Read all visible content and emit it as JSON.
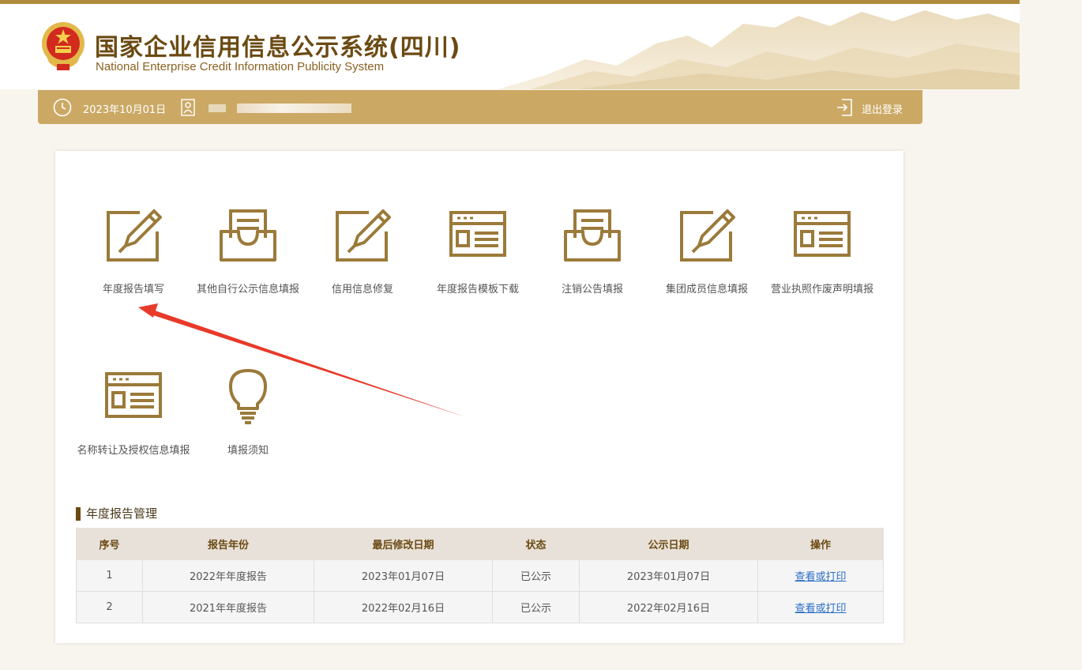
{
  "header": {
    "title_cn": "国家企业信用信息公示系统(四川)",
    "title_en": "National Enterprise Credit Information Publicity System",
    "emblem_icon": "national-emblem-icon"
  },
  "topbar": {
    "date": "2023年10月01日",
    "logout_label": "退出登录",
    "icons": [
      "clock-icon",
      "user-icon",
      "logout-icon"
    ]
  },
  "tiles": [
    {
      "label": "年度报告填写",
      "icon": "edit-pencil-icon"
    },
    {
      "label": "其他自行公示信息填报",
      "icon": "inbox-tray-icon"
    },
    {
      "label": "信用信息修复",
      "icon": "edit-pencil-icon"
    },
    {
      "label": "年度报告模板下载",
      "icon": "form-template-icon"
    },
    {
      "label": "注销公告填报",
      "icon": "inbox-tray-icon"
    },
    {
      "label": "集团成员信息填报",
      "icon": "edit-pencil-icon"
    },
    {
      "label": "营业执照作废声明填报",
      "icon": "form-template-icon"
    },
    {
      "label": "名称转让及授权信息填报",
      "icon": "form-template-icon"
    },
    {
      "label": "填报须知",
      "icon": "lightbulb-icon"
    }
  ],
  "annual_report": {
    "section_title": "年度报告管理",
    "columns": [
      "序号",
      "报告年份",
      "最后修改日期",
      "状态",
      "公示日期",
      "操作"
    ],
    "rows": [
      {
        "no": "1",
        "year": "2022年年度报告",
        "modified": "2023年01月07日",
        "status": "已公示",
        "published": "2023年01月07日",
        "action": "查看或打印"
      },
      {
        "no": "2",
        "year": "2021年年度报告",
        "modified": "2022年02月16日",
        "status": "已公示",
        "published": "2022年02月16日",
        "action": "查看或打印"
      }
    ]
  },
  "colors": {
    "gold": "#cba965",
    "dark_gold": "#9b7a3a",
    "brown": "#6b4a12",
    "annotation_red": "#e83a2a",
    "link": "#2a6fc7"
  }
}
